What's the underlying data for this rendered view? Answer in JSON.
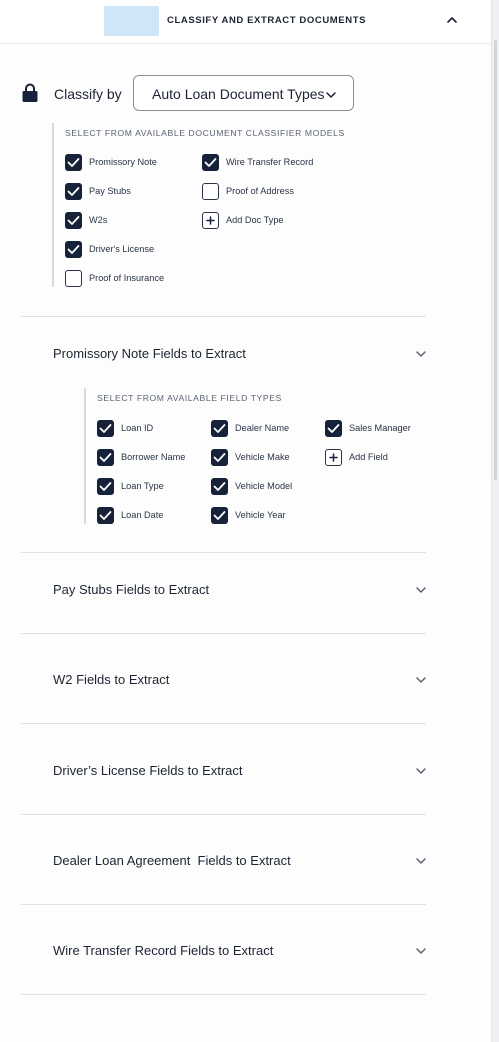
{
  "header": {
    "title": "CLASSIFY AND EXTRACT DOCUMENTS",
    "collapse_icon": "chevron-up-icon"
  },
  "classify": {
    "label": "Classify by",
    "selected": "Auto Loan Document Types",
    "lock_icon": "lock-icon"
  },
  "classifier_models": {
    "heading": "SELECT FROM AVAILABLE DOCUMENT CLASSIFIER MODELS",
    "items": [
      {
        "label": "Promissory Note",
        "checked": true
      },
      {
        "label": "Pay Stubs",
        "checked": true
      },
      {
        "label": "W2s",
        "checked": true
      },
      {
        "label": "Driver's License",
        "checked": true
      },
      {
        "label": "Proof of Insurance",
        "checked": false
      },
      {
        "label": "Wire Transfer Record",
        "checked": true
      },
      {
        "label": "Proof of Address",
        "checked": false
      }
    ],
    "add_label": "Add Doc Type"
  },
  "promissory_note": {
    "title": "Promissory Note Fields to Extract",
    "heading": "SELECT FROM AVAILABLE FIELD TYPES",
    "fields": [
      {
        "label": "Loan ID",
        "checked": true
      },
      {
        "label": "Borrower Name",
        "checked": true
      },
      {
        "label": "Loan Type",
        "checked": true
      },
      {
        "label": "Loan Date",
        "checked": true
      },
      {
        "label": "Dealer Name",
        "checked": true
      },
      {
        "label": "Vehicle Make",
        "checked": true
      },
      {
        "label": "Vehicle Model",
        "checked": true
      },
      {
        "label": "Vehicle Year",
        "checked": true
      },
      {
        "label": "Sales Manager",
        "checked": true
      }
    ],
    "add_label": "Add Field"
  },
  "sections": [
    {
      "title": "Pay Stubs Fields to Extract"
    },
    {
      "title": "W2 Fields to Extract"
    },
    {
      "title": "Driver’s License Fields to Extract"
    },
    {
      "title": "Dealer Loan Agreement  Fields to Extract"
    },
    {
      "title": "Wire Transfer Record Fields to Extract"
    }
  ],
  "colors": {
    "checkbox_fill": "#16213a",
    "header_tile": "#cfe6f8",
    "divider": "#dfe2e6"
  }
}
